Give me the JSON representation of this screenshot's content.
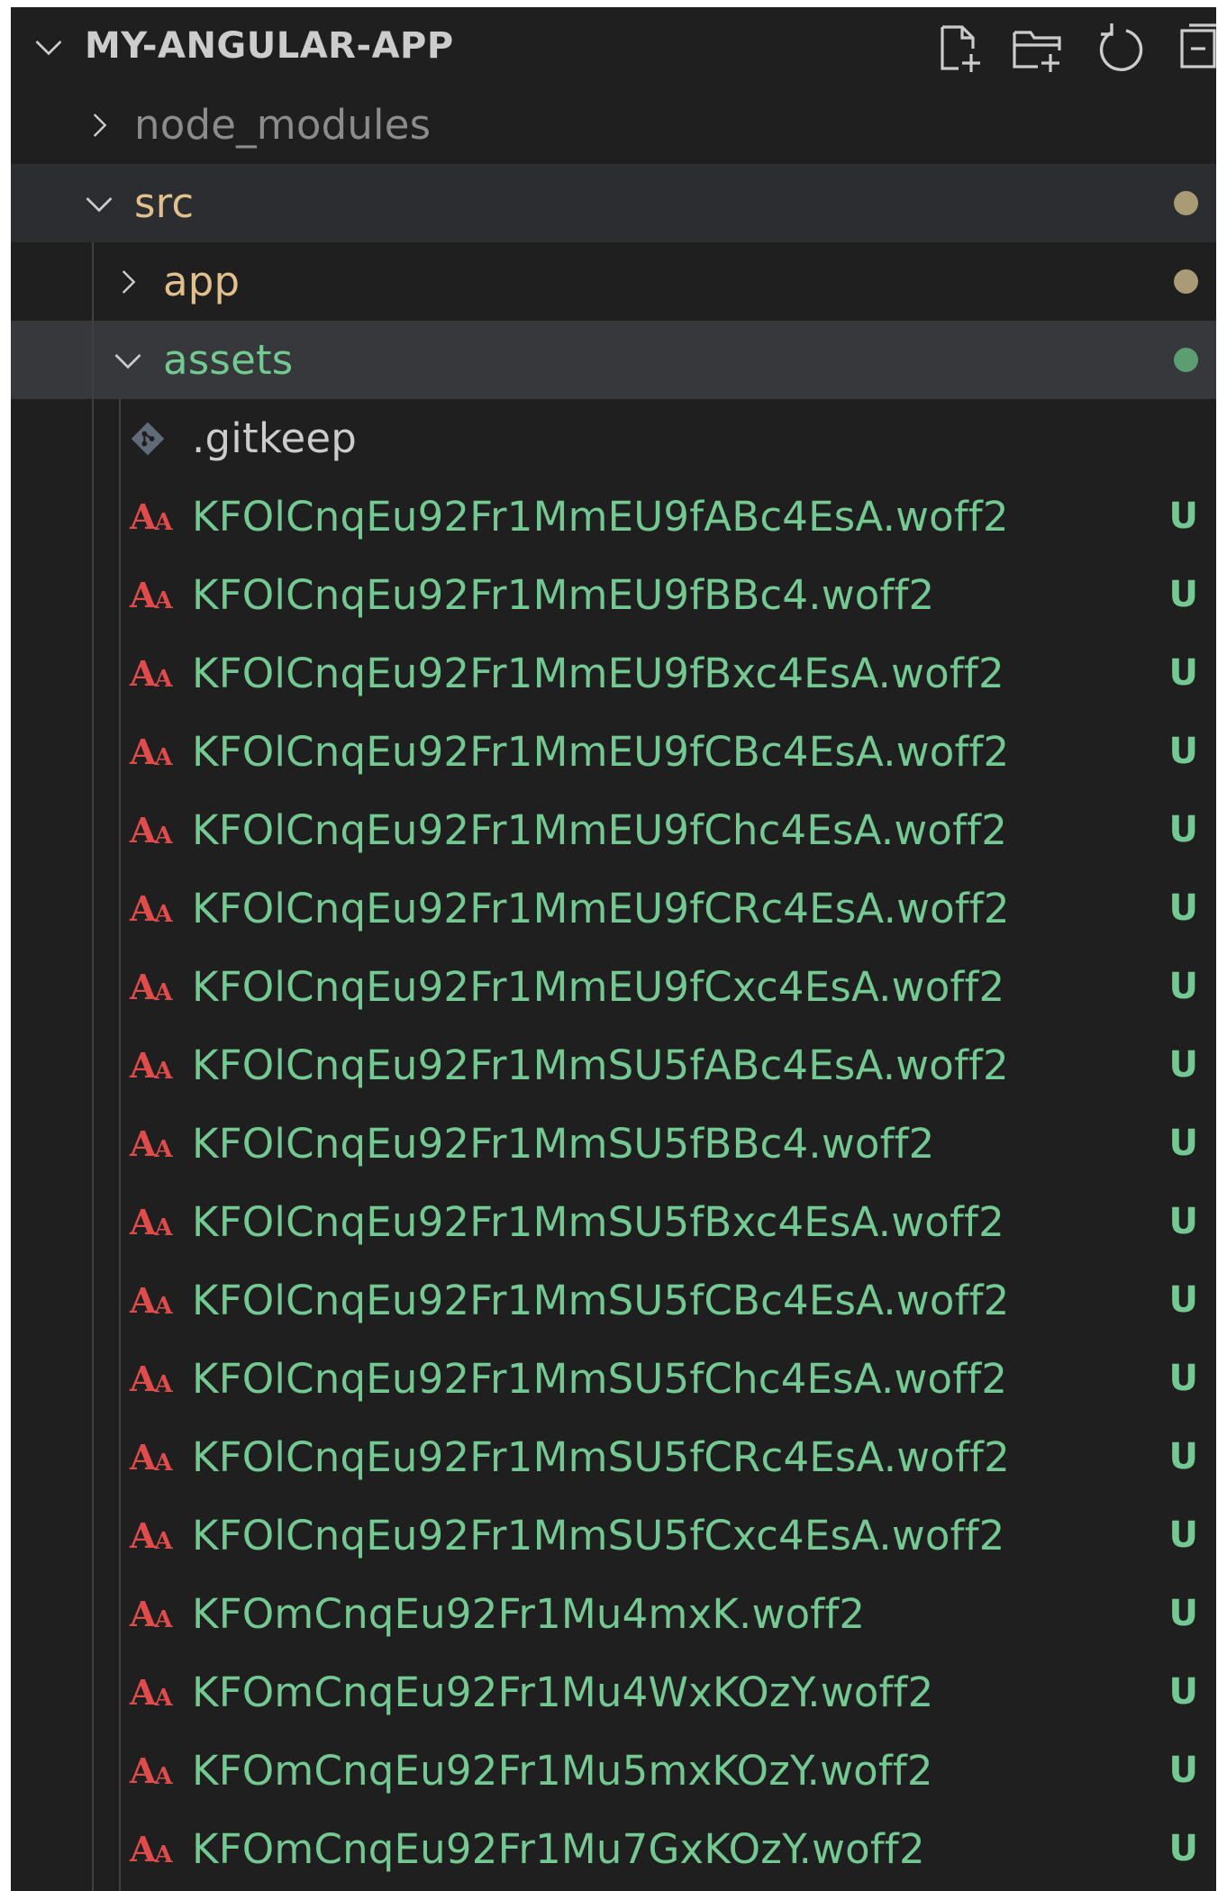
{
  "header": {
    "title": "MY-ANGULAR-APP",
    "actions": [
      {
        "name": "new-file-icon"
      },
      {
        "name": "new-folder-icon"
      },
      {
        "name": "refresh-icon"
      },
      {
        "name": "collapse-all-icon"
      }
    ]
  },
  "tree": {
    "node_modules": {
      "label": "node_modules"
    },
    "src": {
      "label": "src"
    },
    "app": {
      "label": "app"
    },
    "assets": {
      "label": "assets"
    },
    "gitkeep": {
      "label": ".gitkeep"
    },
    "files": [
      {
        "name": "KFOlCnqEu92Fr1MmEU9fABc4EsA.woff2",
        "status": "U"
      },
      {
        "name": "KFOlCnqEu92Fr1MmEU9fBBc4.woff2",
        "status": "U"
      },
      {
        "name": "KFOlCnqEu92Fr1MmEU9fBxc4EsA.woff2",
        "status": "U"
      },
      {
        "name": "KFOlCnqEu92Fr1MmEU9fCBc4EsA.woff2",
        "status": "U"
      },
      {
        "name": "KFOlCnqEu92Fr1MmEU9fChc4EsA.woff2",
        "status": "U"
      },
      {
        "name": "KFOlCnqEu92Fr1MmEU9fCRc4EsA.woff2",
        "status": "U"
      },
      {
        "name": "KFOlCnqEu92Fr1MmEU9fCxc4EsA.woff2",
        "status": "U"
      },
      {
        "name": "KFOlCnqEu92Fr1MmSU5fABc4EsA.woff2",
        "status": "U"
      },
      {
        "name": "KFOlCnqEu92Fr1MmSU5fBBc4.woff2",
        "status": "U"
      },
      {
        "name": "KFOlCnqEu92Fr1MmSU5fBxc4EsA.woff2",
        "status": "U"
      },
      {
        "name": "KFOlCnqEu92Fr1MmSU5fCBc4EsA.woff2",
        "status": "U"
      },
      {
        "name": "KFOlCnqEu92Fr1MmSU5fChc4EsA.woff2",
        "status": "U"
      },
      {
        "name": "KFOlCnqEu92Fr1MmSU5fCRc4EsA.woff2",
        "status": "U"
      },
      {
        "name": "KFOlCnqEu92Fr1MmSU5fCxc4EsA.woff2",
        "status": "U"
      },
      {
        "name": "KFOmCnqEu92Fr1Mu4mxK.woff2",
        "status": "U"
      },
      {
        "name": "KFOmCnqEu92Fr1Mu4WxKOzY.woff2",
        "status": "U"
      },
      {
        "name": "KFOmCnqEu92Fr1Mu5mxKOzY.woff2",
        "status": "U"
      },
      {
        "name": "KFOmCnqEu92Fr1Mu7GxKOzY.woff2",
        "status": "U"
      }
    ],
    "file_icon": "font-file-icon",
    "gitkeep_icon": "git-icon"
  },
  "colors": {
    "background": "#1f1f1f",
    "untracked_green": "#73c991",
    "modified_gold": "#e2c08d",
    "folder_modified_dot": "#a89b75",
    "folder_untracked_dot": "#5c9e72",
    "font_icon_red": "#e04b4b",
    "default_text": "#cccccc",
    "muted_text": "#8c8c8c"
  }
}
